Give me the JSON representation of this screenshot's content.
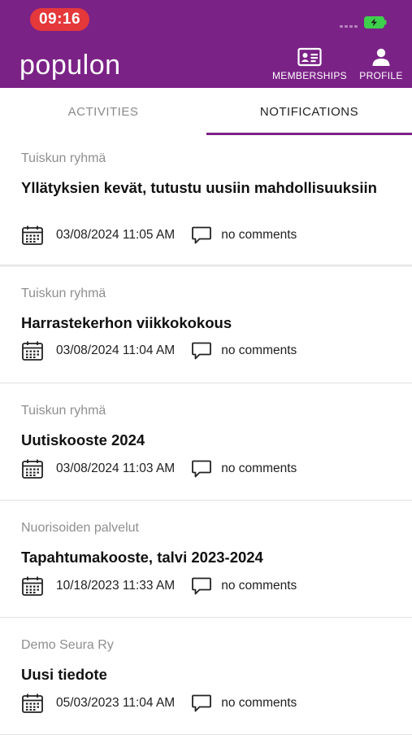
{
  "status_bar": {
    "time": "09:16"
  },
  "header": {
    "logo": "populon",
    "memberships_label": "MEMBERSHIPS",
    "profile_label": "PROFILE"
  },
  "tabs": {
    "activities": "ACTIVITIES",
    "notifications": "NOTIFICATIONS",
    "active": "notifications"
  },
  "colors": {
    "brand": "#7b2287",
    "status_pill": "#e5383b",
    "battery": "#3ecf4c"
  },
  "notifications": [
    {
      "source": "Tuiskun ryhmä",
      "title": "Yllätyksien kevät, tutustu uusiin mahdollisuuksiin",
      "date": "03/08/2024 11:05 AM",
      "comments": "no comments"
    },
    {
      "source": "Tuiskun ryhmä",
      "title": "Harrastekerhon viikkokokous",
      "date": "03/08/2024 11:04 AM",
      "comments": "no comments"
    },
    {
      "source": "Tuiskun ryhmä",
      "title": "Uutiskooste 2024",
      "date": "03/08/2024 11:03 AM",
      "comments": "no comments"
    },
    {
      "source": "Nuorisoiden palvelut",
      "title": "Tapahtumakooste, talvi 2023-2024",
      "date": "10/18/2023 11:33 AM",
      "comments": "no comments"
    },
    {
      "source": "Demo Seura Ry",
      "title": "Uusi tiedote",
      "date": "05/03/2023 11:04 AM",
      "comments": "no comments"
    }
  ]
}
